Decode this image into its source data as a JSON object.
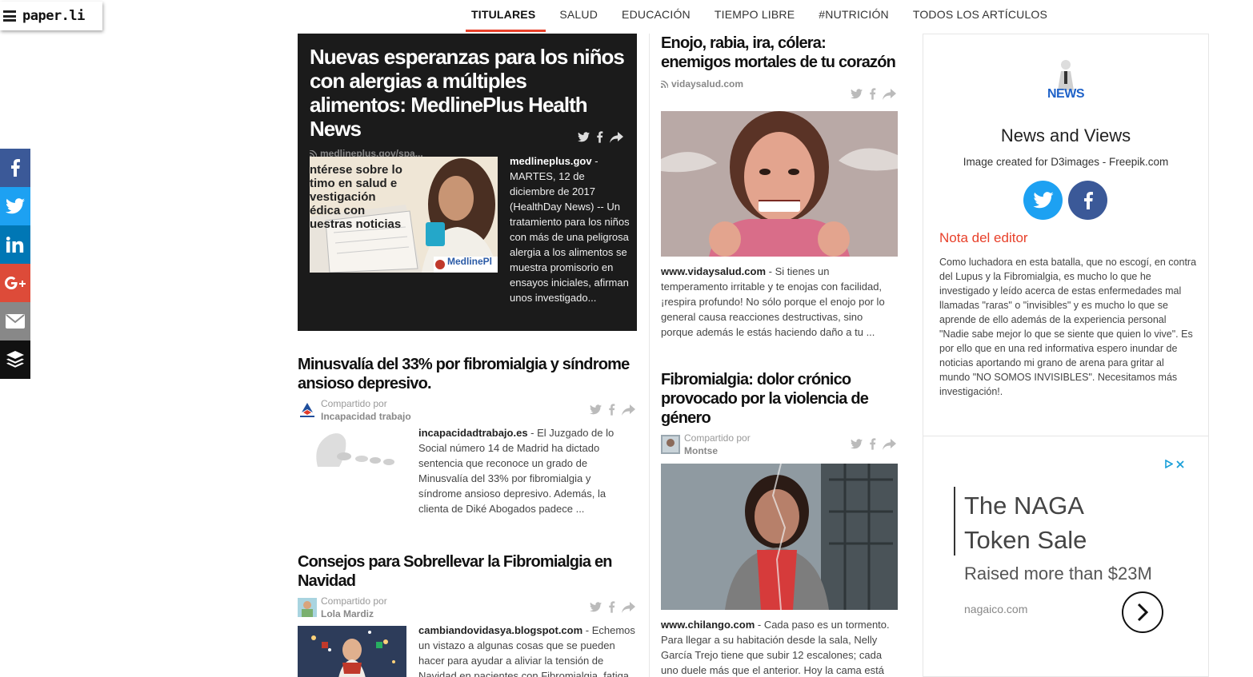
{
  "logo": {
    "text": "paper.li"
  },
  "nav": {
    "tabs": [
      {
        "label": "TITULARES",
        "active": true
      },
      {
        "label": "SALUD"
      },
      {
        "label": "EDUCACIÓN"
      },
      {
        "label": "TIEMPO LIBRE"
      },
      {
        "label": "#NUTRICIÓN"
      },
      {
        "label": "TODOS LOS ARTÍCULOS"
      }
    ]
  },
  "share_bar": [
    {
      "icon": "facebook-icon",
      "color": "#3b5998"
    },
    {
      "icon": "twitter-icon",
      "color": "#1da1f2"
    },
    {
      "icon": "linkedin-icon",
      "color": "#0077b5"
    },
    {
      "icon": "google-plus-icon",
      "color": "#dd4b39"
    },
    {
      "icon": "email-icon",
      "color": "#888888"
    },
    {
      "icon": "buffer-icon",
      "color": "#111111"
    }
  ],
  "hero": {
    "title": "Nuevas esperanzas para los niños con alergias a múltiples alimentos: MedlinePlus Health News",
    "source": "medlineplus.gov/spa...",
    "body_source": "medlineplus.gov",
    "body_text": " - MARTES, 12 de diciembre de 2017 (HealthDay News) -- Un tratamiento para los niños con más de una peligrosa alergia a los alimentos se muestra promisorio en ensayos iniciales, afirman unos investigado...",
    "image_overlay": "ntérese sobre lo\ntimo en salud e\nvestigación\nédica con\nuestras noticias",
    "image_brand": "MedlinePl"
  },
  "col1_articles": [
    {
      "title": "Minusvalía del 33% por fibromialgia y síndrome ansioso depresivo.",
      "shared_label": "Compartido por",
      "shared_by": "Incapacidad trabajo",
      "source": "incapacidadtrabajo.es",
      "text": " - El Juzgado de lo Social número 14 de Madrid ha dictado sentencia que reconoce un grado de Minusvalía del 33% por fibromialgia y síndrome ansioso depresivo. Además, la clienta de Diké Abogados padece ..."
    },
    {
      "title": "Consejos para Sobrellevar la Fibromialgia en Navidad",
      "shared_label": "Compartido por",
      "shared_by": "Lola Mardiz",
      "source": "cambiandovidasya.blogspot.com",
      "text": " - Echemos un vistazo a algunas cosas que se pueden hacer para ayudar a aliviar la tensión de Navidad en pacientes con Fibromialgia, fatiga crónica, lupus y otras enfermedades"
    }
  ],
  "col2_articles": [
    {
      "title": "Enojo, rabia, ira, cólera: enemigos mortales de tu corazón",
      "source_line": "vidaysalud.com",
      "source": "www.vidaysalud.com",
      "text": " - Si tienes un temperamento irritable y te enojas con facilidad, ¡respira profundo! No sólo porque el enojo por lo general causa reacciones destructivas, sino porque además le estás haciendo daño a tu ..."
    },
    {
      "title": "Fibromialgia: dolor crónico provocado por la violencia de género",
      "shared_label": "Compartido por",
      "shared_by": "Montse",
      "source": "www.chilango.com",
      "text": " - Cada paso es un tormento. Para llegar a su habitación desde la sala, Nelly García Trejo tiene que subir 12 escalones; cada uno duele más que el anterior. Hoy la cama está sin hacer, Nelly no encontró..."
    }
  ],
  "sidebar": {
    "logo_text": "NEWS",
    "title": "News and Views",
    "caption": "Image created for D3images - Freepik.com",
    "editor_heading": "Nota del editor",
    "editor_text": "Como luchadora en esta batalla, que no escogí, en contra del Lupus y la Fibromialgia, es mucho lo que he investigado y leído acerca de estas enfermedades mal llamadas \"raras\" o \"invisibles\" y es mucho lo que se aprende de ello además de la experiencia personal \"Nadie sabe mejor lo que se siente que quien lo vive\". Es por ello que en una red informativa espero inundar de noticias aportando mi grano de arena para gritar al mundo \"NO SOMOS INVISIBLES\". Necesitamos más investigación!.",
    "ad": {
      "title_line1": "The NAGA",
      "title_line2": "Token Sale",
      "subtitle": "Raised more than $23M",
      "url": "nagaico.com"
    }
  },
  "colors": {
    "accent": "#e8402a",
    "twitter": "#1da1f2",
    "facebook": "#3b5998"
  }
}
